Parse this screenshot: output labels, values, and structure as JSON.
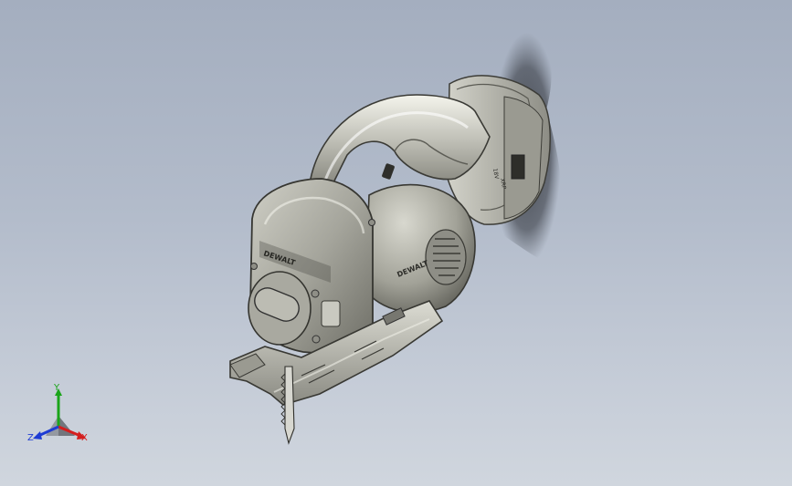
{
  "viewport": {
    "background_top": "#a4aebf",
    "background_bottom": "#d0d6de"
  },
  "model": {
    "brand_text": "DEWALT",
    "battery_labels": [
      "18V",
      "XRP"
    ]
  },
  "triad": {
    "x_label": "X",
    "y_label": "Y",
    "z_label": "Z",
    "x_color": "#d41e1e",
    "y_color": "#1aa51a",
    "z_color": "#1e3cd4"
  }
}
